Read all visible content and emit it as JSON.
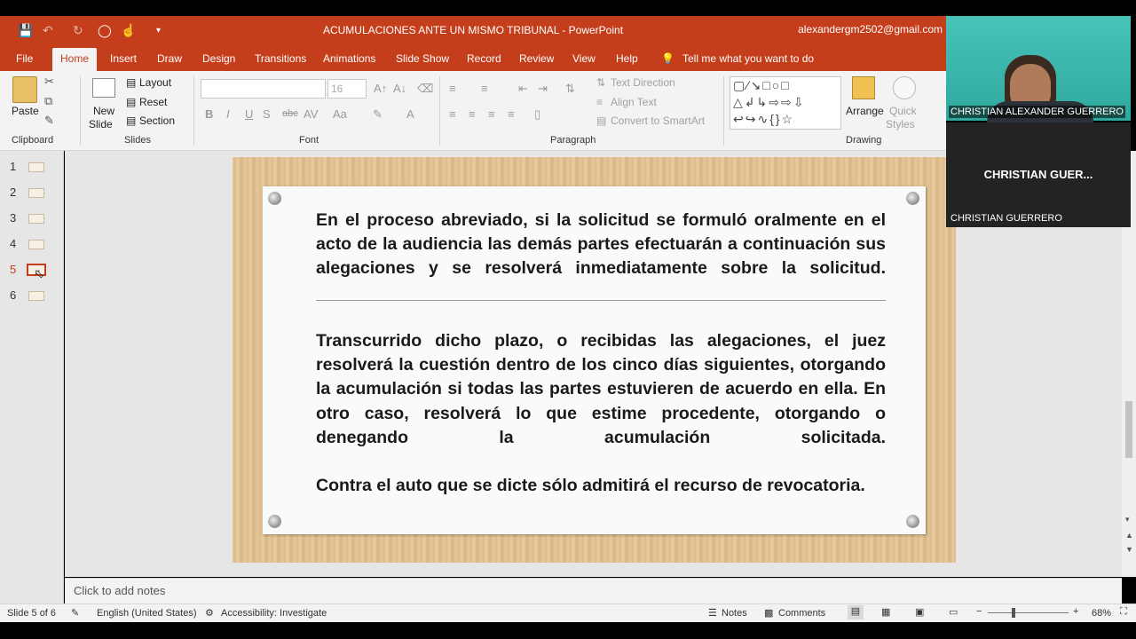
{
  "window": {
    "title": "ACUMULACIONES ANTE UN MISMO TRIBUNAL  -  PowerPoint",
    "account": "alexandergm2502@gmail.com"
  },
  "menu": {
    "items": [
      "File",
      "Home",
      "Insert",
      "Draw",
      "Design",
      "Transitions",
      "Animations",
      "Slide Show",
      "Record",
      "Review",
      "View",
      "Help"
    ],
    "active": "Home",
    "tell_me": "Tell me what you want to do"
  },
  "ribbon": {
    "clipboard": {
      "paste": "Paste",
      "label": "Clipboard"
    },
    "slides": {
      "new_slide_1": "New",
      "new_slide_2": "Slide",
      "layout": "Layout",
      "reset": "Reset",
      "section": "Section",
      "label": "Slides"
    },
    "font": {
      "size": "16",
      "label": "Font",
      "bold": "B",
      "italic": "I",
      "underline": "U",
      "strike": "abc"
    },
    "paragraph": {
      "text_direction": "Text Direction",
      "align_text": "Align Text",
      "smartart": "Convert to SmartArt",
      "label": "Paragraph"
    },
    "drawing": {
      "arrange": "Arrange",
      "quick_styles_1": "Quick",
      "quick_styles_2": "Styles",
      "label": "Drawing"
    }
  },
  "thumbnails": {
    "numbers": [
      "1",
      "2",
      "3",
      "4",
      "5",
      "6"
    ],
    "active": "5"
  },
  "slide": {
    "para1": "En el proceso abreviado, si la solicitud se formuló oralmente en el acto de la audiencia las demás partes efectuarán a continuación sus alegaciones y se resolverá inmediatamente sobre la solicitud.",
    "para2": "Transcurrido dicho plazo, o recibidas las alegaciones, el juez resolverá la cuestión dentro de los cinco días siguientes, otorgando la acumulación si todas las partes estuvieren de acuerdo en ella. En otro caso, resolverá lo que estime procedente, otorgando o denegando la acumulación solicitada.",
    "para3": "Contra el auto que se dicte sólo admitirá el recurso de revocatoria."
  },
  "notes": {
    "placeholder": "Click to add notes"
  },
  "status": {
    "slide": "Slide 5 of 6",
    "language": "English (United States)",
    "accessibility": "Accessibility: Investigate",
    "notes": "Notes",
    "comments": "Comments",
    "zoom": "68%"
  },
  "video": {
    "tile1_name": "CHRISTIAN ALEXANDER GUERRERO",
    "tile2_center": "CHRISTIAN  GUER...",
    "tile2_name": "CHRISTIAN GUERRERO"
  }
}
